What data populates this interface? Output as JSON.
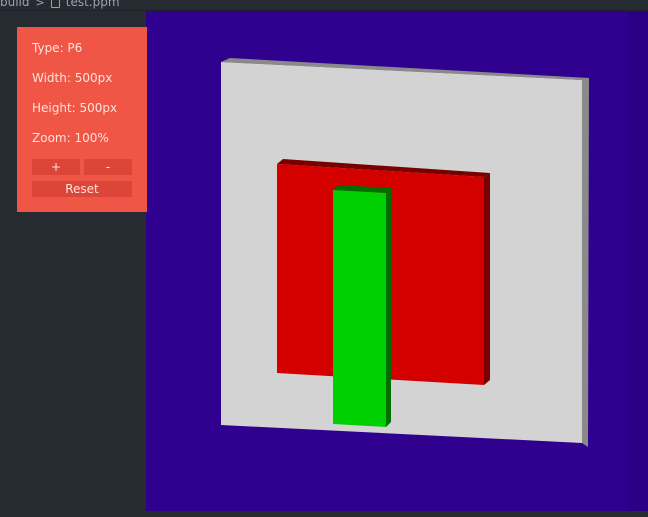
{
  "breadcrumb": {
    "parent": "build",
    "separator": ">",
    "file": "test.ppm"
  },
  "colors": {
    "canvas_bg": "#30008f",
    "panel_bg": "#ef5646",
    "white_square": "#d3d3d3",
    "red_rect": "#d40000",
    "green_bar": "#00d000"
  },
  "info_panel": {
    "type": "Type: P6",
    "width": "Width: 500px",
    "height": "Height: 500px",
    "zoom": "Zoom: 100%",
    "zoom_in_label": "+",
    "zoom_out_label": "-",
    "reset_label": "Reset"
  }
}
